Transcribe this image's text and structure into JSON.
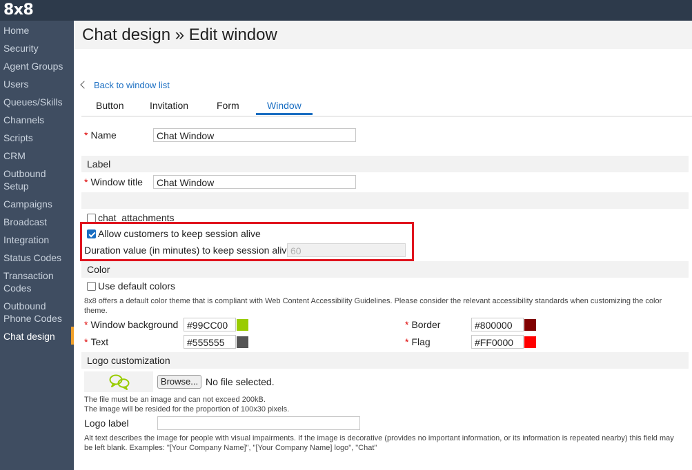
{
  "app": {
    "logo": "8x8"
  },
  "sidebar": {
    "items": [
      {
        "label": "Home"
      },
      {
        "label": "Security"
      },
      {
        "label": "Agent Groups"
      },
      {
        "label": "Users"
      },
      {
        "label": "Queues/Skills"
      },
      {
        "label": "Channels"
      },
      {
        "label": "Scripts"
      },
      {
        "label": "CRM"
      },
      {
        "label": "Outbound",
        "label2": "Setup"
      },
      {
        "label": "Campaigns"
      },
      {
        "label": "Broadcast"
      },
      {
        "label": "Integration"
      },
      {
        "label": "Status Codes"
      },
      {
        "label": "Transaction",
        "label2": "Codes"
      },
      {
        "label": "Outbound",
        "label2": "Phone Codes"
      },
      {
        "label": "Chat design"
      }
    ],
    "active": "Chat design"
  },
  "header": {
    "title": "Chat design » Edit window"
  },
  "back_link": "Back to window list",
  "tabs": [
    {
      "label": "Button"
    },
    {
      "label": "Invitation"
    },
    {
      "label": "Form"
    },
    {
      "label": "Window"
    }
  ],
  "active_tab": "Window",
  "form": {
    "name": {
      "label": "Name",
      "value": "Chat Window",
      "required_mark": "*"
    },
    "label_section": "Label",
    "window_title": {
      "label": "Window title",
      "value": "Chat Window",
      "required_mark": "*"
    },
    "chat_attachments": {
      "label": "chat_attachments",
      "checked": false
    },
    "keep_alive": {
      "label": "Allow customers to keep session alive",
      "checked": true
    },
    "duration": {
      "label": "Duration value (in minutes) to keep session alive:",
      "value": "60"
    },
    "color_section": "Color",
    "use_default_colors": {
      "label": "Use default colors",
      "checked": false
    },
    "color_note": "8x8 offers a default color theme that is compliant with Web Content Accessibility Guidelines. Please consider the relevant accessibility standards when customizing the color theme.",
    "colors": {
      "window_background": {
        "label": "Window background",
        "value": "#99CC00"
      },
      "text": {
        "label": "Text",
        "value": "#555555"
      },
      "border": {
        "label": "Border",
        "value": "#800000"
      },
      "flag": {
        "label": "Flag",
        "value": "#FF0000"
      }
    },
    "logo_section": "Logo customization",
    "browse_label": "Browse...",
    "no_file": "No file selected.",
    "file_note_1": "The file must be an image and can not exceed 200kB.",
    "file_note_2": "The image will be resided for the proportion of 100x30 pixels.",
    "logo_label": {
      "label": "Logo label",
      "value": ""
    },
    "alt_note": "Alt text describes the image for people with visual impairments. If the image is decorative (provides no important information, or its information is repeated nearby) this field may be left blank. Examples: \"[Your Company Name]\", \"[Your Company Name] logo\", \"Chat\""
  }
}
